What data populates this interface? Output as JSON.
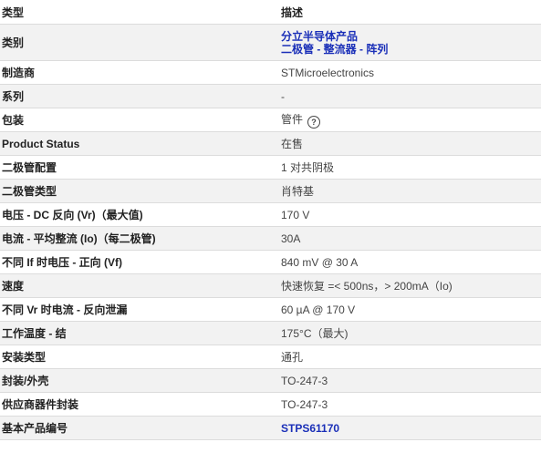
{
  "header": {
    "col_attribute": "类型",
    "col_description": "描述"
  },
  "rows": {
    "category": {
      "label": "类别",
      "link1": "分立半导体产品",
      "link2": "二极管 - 整流器 - 阵列"
    },
    "manufacturer": {
      "label": "制造商",
      "value": "STMicroelectronics"
    },
    "series": {
      "label": "系列",
      "value": "-"
    },
    "package": {
      "label": "包装",
      "value": "管件",
      "help_icon": "help-circle-icon",
      "help_glyph": "?"
    },
    "product_status": {
      "label": "Product Status",
      "value": "在售"
    },
    "diode_config": {
      "label": "二极管配置",
      "value": "1 对共阴极"
    },
    "diode_type": {
      "label": "二极管类型",
      "value": "肖特基"
    },
    "voltage_dc_reverse": {
      "label": "电压 - DC 反向 (Vr)（最大值)",
      "value": "170 V"
    },
    "current_avg_rectified": {
      "label": "电流 - 平均整流 (Io)（每二极管)",
      "value": "30A"
    },
    "voltage_forward": {
      "label": "不同 If 时电压 - 正向 (Vf)",
      "value": "840 mV @ 30 A"
    },
    "speed": {
      "label": "速度",
      "value": "快速恢复 =< 500ns，> 200mA（Io)"
    },
    "current_reverse_leakage": {
      "label": "不同 Vr 时电流 - 反向泄漏",
      "value": "60 µA @ 170 V"
    },
    "operating_temp": {
      "label": "工作温度 - 结",
      "value": "175°C（最大)"
    },
    "mounting_type": {
      "label": "安装类型",
      "value": "通孔"
    },
    "package_case": {
      "label": "封装/外壳",
      "value": "TO-247-3"
    },
    "supplier_package": {
      "label": "供应商器件封装",
      "value": "TO-247-3"
    },
    "base_part_number": {
      "label": "基本产品编号",
      "value": "STPS61170"
    }
  },
  "colors": {
    "link": "#1a2fb8",
    "stripe": "#f2f2f2",
    "border": "#dcdcdc"
  }
}
